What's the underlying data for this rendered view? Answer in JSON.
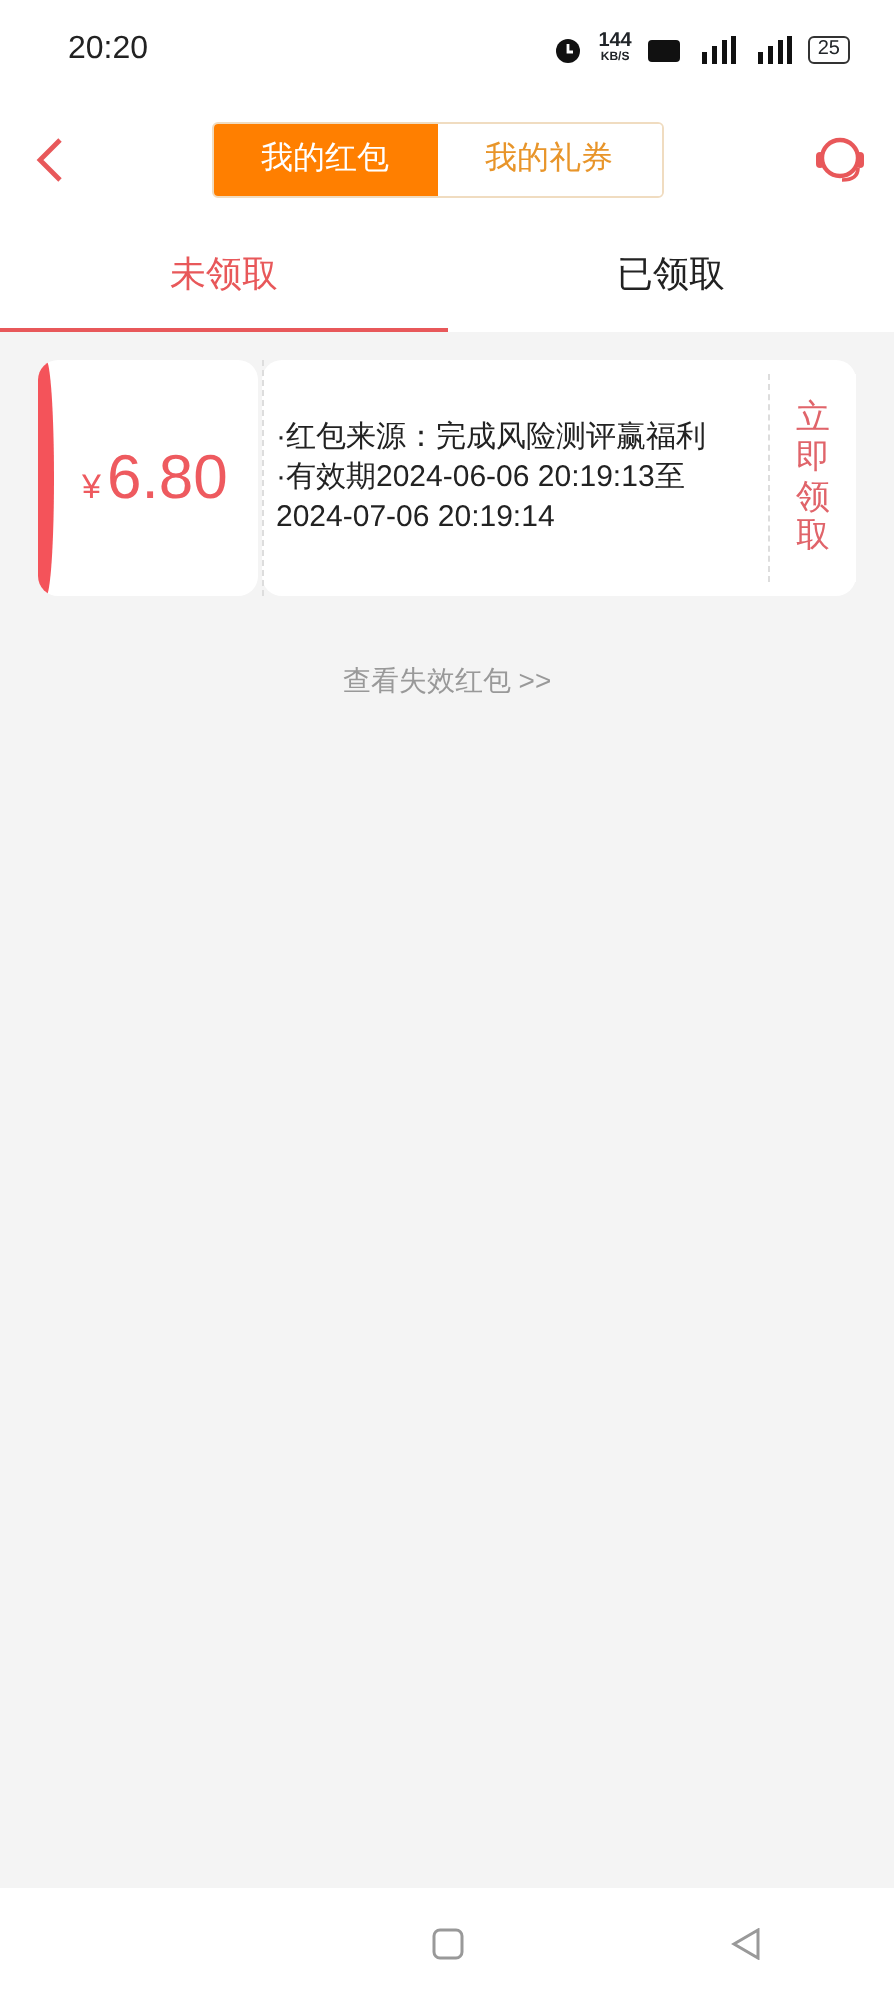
{
  "status_bar": {
    "time": "20:20",
    "speed": "144",
    "speed_unit": "KB/S",
    "battery": "25"
  },
  "segments": [
    {
      "label": "我的红包",
      "selected": true
    },
    {
      "label": "我的礼券",
      "selected": false
    }
  ],
  "tabs": [
    {
      "label": "未领取",
      "selected": true
    },
    {
      "label": "已领取",
      "selected": false
    }
  ],
  "coupons": [
    {
      "currency": "¥",
      "amount": "6.80",
      "lines": [
        "·红包来源：完成风险测评赢福利",
        "·有效期2024-06-06 20:19:13至2024-07-06 20:19:14"
      ],
      "action": "立即领取"
    }
  ],
  "footer_link": "查看失效红包 >>"
}
